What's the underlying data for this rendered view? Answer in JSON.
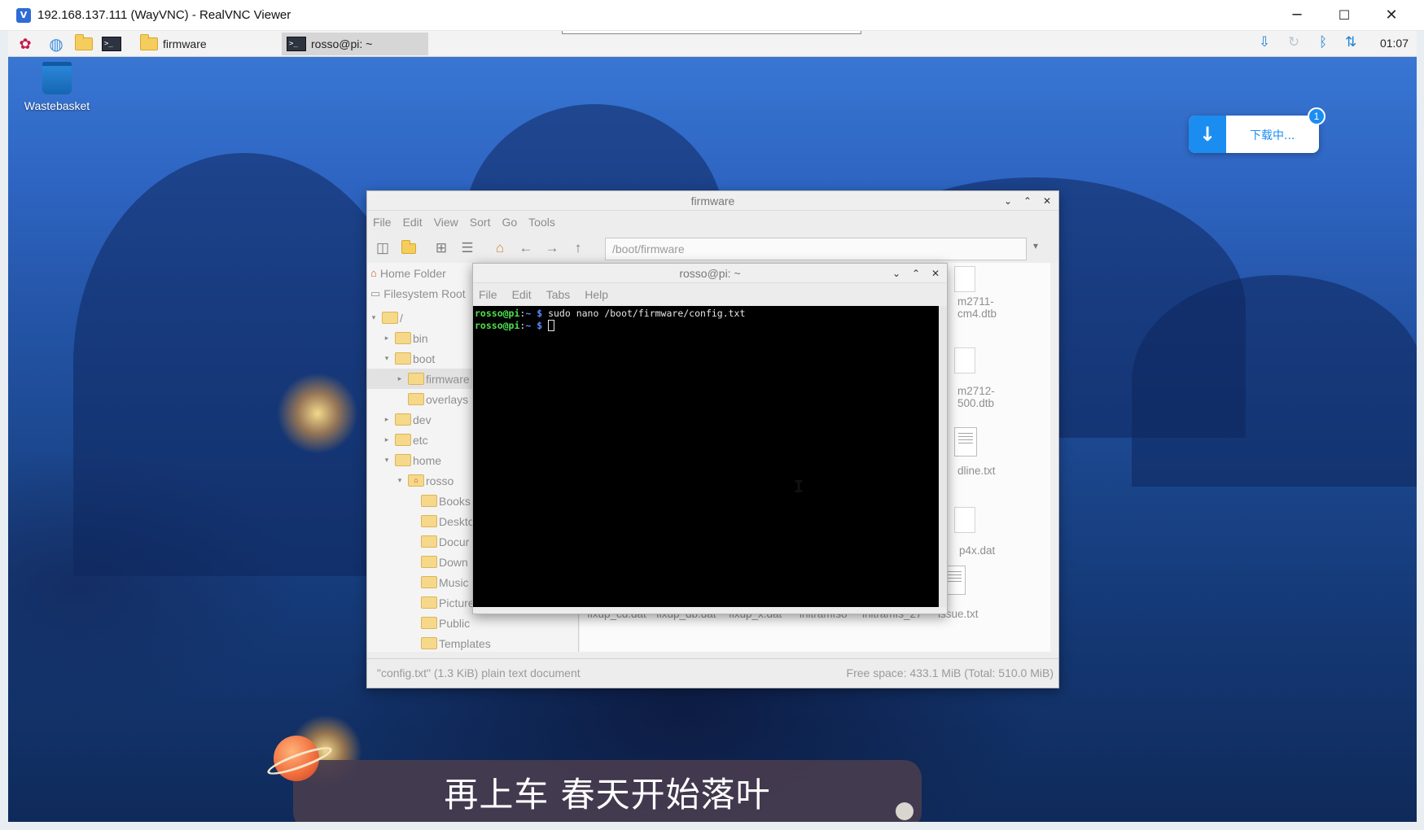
{
  "host": {
    "title": "192.168.137.111 (WayVNC) - RealVNC Viewer",
    "controls": {
      "minimize": "─",
      "maximize": "☐",
      "close": "✕"
    }
  },
  "taskbar": {
    "apps": [
      "raspberry-menu",
      "browser",
      "file-manager",
      "terminal"
    ],
    "windows": [
      {
        "label": "firmware",
        "icon": "folder-icon"
      },
      {
        "label": "rosso@pi: ~",
        "icon": "terminal-icon"
      }
    ],
    "tray": [
      "download-icon",
      "sync-icon",
      "bluetooth-icon",
      "network-icon"
    ],
    "clock": "01:07"
  },
  "desktop": {
    "wastebasket_label": "Wastebasket"
  },
  "download_widget": {
    "text": "下载中...",
    "badge": "1",
    "accent": "#1c8df0"
  },
  "file_manager": {
    "title": "firmware",
    "menu": [
      "File",
      "Edit",
      "View",
      "Sort",
      "Go",
      "Tools"
    ],
    "path": "/boot/firmware",
    "places": [
      {
        "label": "Home Folder",
        "icon": "home-icon"
      },
      {
        "label": "Filesystem Root",
        "icon": "drive-icon"
      }
    ],
    "tree": [
      {
        "label": "/",
        "expanded": true
      },
      {
        "label": "bin",
        "expanded": false
      },
      {
        "label": "boot",
        "expanded": true
      },
      {
        "label": "firmware",
        "expanded": false,
        "selected": true
      },
      {
        "label": "overlays",
        "expanded": false
      },
      {
        "label": "dev",
        "expanded": false
      },
      {
        "label": "etc",
        "expanded": false
      },
      {
        "label": "home",
        "expanded": true
      },
      {
        "label": "rosso",
        "expanded": true
      },
      {
        "label": "Books"
      },
      {
        "label": "Deskto"
      },
      {
        "label": "Docur"
      },
      {
        "label": "Down"
      },
      {
        "label": "Music"
      },
      {
        "label": "Picture"
      },
      {
        "label": "Public"
      },
      {
        "label": "Templates"
      }
    ],
    "files_right_col": [
      {
        "line1": "m2711-",
        "line2": "cm4.dtb"
      },
      {
        "line1": "m2712-",
        "line2": "500.dtb"
      },
      {
        "line1": "dline.txt",
        "line2": ""
      },
      {
        "line1": "p4x.dat",
        "line2": ""
      }
    ],
    "files_bottom_row": [
      "fixup_cd.dat",
      "fixup_db.dat",
      "fixup_x.dat",
      "initramfs8",
      "initramfs_27",
      "issue.txt"
    ],
    "status_left": "\"config.txt\" (1.3 KiB) plain text document",
    "status_right": "Free space: 433.1 MiB (Total: 510.0 MiB)"
  },
  "terminal": {
    "title": "rosso@pi: ~",
    "menu": [
      "File",
      "Edit",
      "Tabs",
      "Help"
    ],
    "lines": [
      {
        "prompt": "rosso@pi",
        "dir": "~",
        "cmd": "sudo nano /boot/firmware/config.txt"
      },
      {
        "prompt": "rosso@pi",
        "dir": "~",
        "cmd": ""
      }
    ]
  },
  "subtitle": {
    "text": "再上车 春天开始落叶"
  }
}
